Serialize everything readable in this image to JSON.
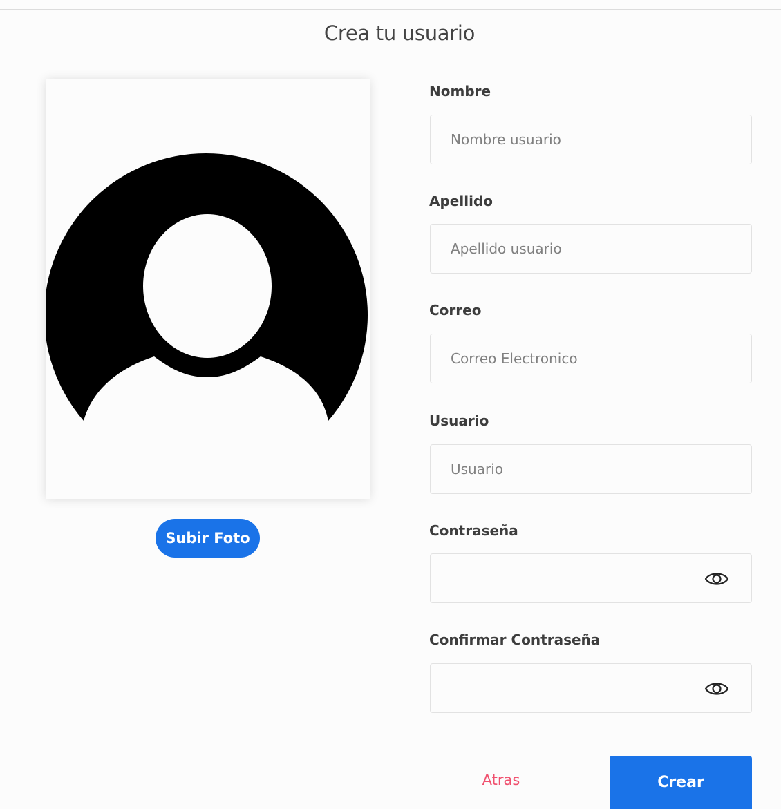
{
  "page": {
    "title": "Crea tu usuario"
  },
  "avatar": {
    "icon": "user-silhouette-icon",
    "upload_label": "Subir Foto"
  },
  "form": {
    "fields": [
      {
        "label": "Nombre",
        "placeholder": "Nombre usuario",
        "type": "text",
        "value": ""
      },
      {
        "label": "Apellido",
        "placeholder": "Apellido usuario",
        "type": "text",
        "value": ""
      },
      {
        "label": "Correo",
        "placeholder": "Correo Electronico",
        "type": "email",
        "value": ""
      },
      {
        "label": "Usuario",
        "placeholder": "Usuario",
        "type": "text",
        "value": ""
      },
      {
        "label": "Contraseña",
        "placeholder": "",
        "type": "password",
        "value": "",
        "toggle_icon": "eye-icon"
      },
      {
        "label": "Confirmar Contraseña",
        "placeholder": "",
        "type": "password",
        "value": "",
        "toggle_icon": "eye-icon"
      }
    ],
    "back_label": "Atras",
    "submit_label": "Crear"
  },
  "colors": {
    "primary": "#1a73e8",
    "back_link": "#f0506e",
    "field_border": "#e2e2e2",
    "background": "#fcfcfc"
  }
}
